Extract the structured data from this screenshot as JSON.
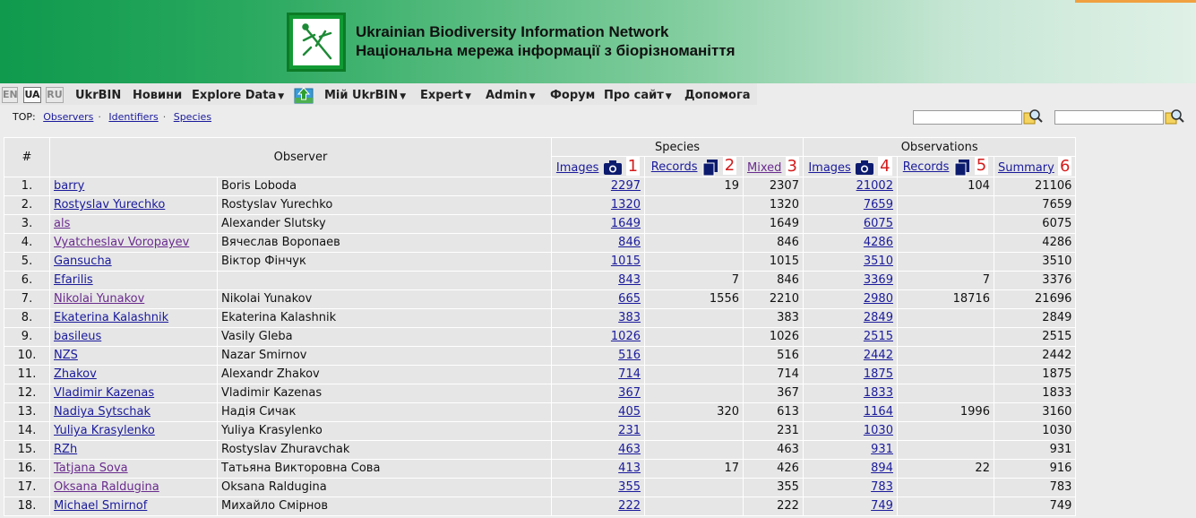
{
  "banner": {
    "title_en": "Ukrainian Biodiversity Information Network",
    "title_ua": "Національна мережа інформації з біорізноманіття"
  },
  "languages": [
    {
      "code": "EN",
      "active": false
    },
    {
      "code": "UA",
      "active": true
    },
    {
      "code": "RU",
      "active": false
    }
  ],
  "menu": {
    "ukrbin": "UkrBIN",
    "news": "Новини",
    "explore": "Explore Data",
    "my": "Мій UkrBIN",
    "expert": "Expert",
    "admin": "Admin",
    "forum": "Форум",
    "about": "Про сайт",
    "help": "Допомога"
  },
  "top": {
    "label": "TOP:",
    "observers": "Observers",
    "identifiers": "Identifiers",
    "species": "Species"
  },
  "table": {
    "h_num": "#",
    "h_observer": "Observer",
    "h_species": "Species",
    "h_observations": "Observations",
    "sp_images": "Images",
    "sp_records": "Records",
    "sp_mixed": "Mixed",
    "ob_images": "Images",
    "ob_records": "Records",
    "ob_summary": "Summary",
    "markers": [
      "1",
      "2",
      "3",
      "4",
      "5",
      "6"
    ],
    "rows": [
      {
        "n": "1.",
        "login": "barry",
        "name": "Boris Loboda",
        "si": "2297",
        "sr": "19",
        "sm": "2307",
        "oi": "21002",
        "or": "104",
        "os": "21106",
        "v": false
      },
      {
        "n": "2.",
        "login": "Rostyslav Yurechko",
        "name": "Rostyslav Yurechko",
        "si": "1320",
        "sr": "",
        "sm": "1320",
        "oi": "7659",
        "or": "",
        "os": "7659",
        "v": false
      },
      {
        "n": "3.",
        "login": "als",
        "name": "Alexander Slutsky",
        "si": "1649",
        "sr": "",
        "sm": "1649",
        "oi": "6075",
        "or": "",
        "os": "6075",
        "v": true
      },
      {
        "n": "4.",
        "login": "Vyatcheslav Voropayev",
        "name": "Вячеслав Воропаев",
        "si": "846",
        "sr": "",
        "sm": "846",
        "oi": "4286",
        "or": "",
        "os": "4286",
        "v": true
      },
      {
        "n": "5.",
        "login": "Gansucha",
        "name": "Віктор Фінчук",
        "si": "1015",
        "sr": "",
        "sm": "1015",
        "oi": "3510",
        "or": "",
        "os": "3510",
        "v": false
      },
      {
        "n": "6.",
        "login": "Efarilis",
        "name": "",
        "si": "843",
        "sr": "7",
        "sm": "846",
        "oi": "3369",
        "or": "7",
        "os": "3376",
        "v": false
      },
      {
        "n": "7.",
        "login": "Nikolai Yunakov",
        "name": "Nikolai Yunakov",
        "si": "665",
        "sr": "1556",
        "sm": "2210",
        "oi": "2980",
        "or": "18716",
        "os": "21696",
        "v": true
      },
      {
        "n": "8.",
        "login": "Ekaterina Kalashnik",
        "name": "Ekaterina Kalashnik",
        "si": "383",
        "sr": "",
        "sm": "383",
        "oi": "2849",
        "or": "",
        "os": "2849",
        "v": false
      },
      {
        "n": "9.",
        "login": "basileus",
        "name": "Vasily Gleba",
        "si": "1026",
        "sr": "",
        "sm": "1026",
        "oi": "2515",
        "or": "",
        "os": "2515",
        "v": false
      },
      {
        "n": "10.",
        "login": "NZS",
        "name": "Nazar Smirnov",
        "si": "516",
        "sr": "",
        "sm": "516",
        "oi": "2442",
        "or": "",
        "os": "2442",
        "v": false
      },
      {
        "n": "11.",
        "login": "Zhakov",
        "name": "Alexandr Zhakov",
        "si": "714",
        "sr": "",
        "sm": "714",
        "oi": "1875",
        "or": "",
        "os": "1875",
        "v": false
      },
      {
        "n": "12.",
        "login": "Vladimir Kazenas",
        "name": "Vladimir Kazenas",
        "si": "367",
        "sr": "",
        "sm": "367",
        "oi": "1833",
        "or": "",
        "os": "1833",
        "v": false
      },
      {
        "n": "13.",
        "login": "Nadiya Sytschak",
        "name": "Надія Сичак",
        "si": "405",
        "sr": "320",
        "sm": "613",
        "oi": "1164",
        "or": "1996",
        "os": "3160",
        "v": false
      },
      {
        "n": "14.",
        "login": "Yuliya Krasylenko",
        "name": "Yuliya Krasylenko",
        "si": "231",
        "sr": "",
        "sm": "231",
        "oi": "1030",
        "or": "",
        "os": "1030",
        "v": false
      },
      {
        "n": "15.",
        "login": "RZh",
        "name": "Rostyslav Zhuravchak",
        "si": "463",
        "sr": "",
        "sm": "463",
        "oi": "931",
        "or": "",
        "os": "931",
        "v": false
      },
      {
        "n": "16.",
        "login": "Tatjana Sova",
        "name": "Татьяна Викторовна Сова",
        "si": "413",
        "sr": "17",
        "sm": "426",
        "oi": "894",
        "or": "22",
        "os": "916",
        "v": true
      },
      {
        "n": "17.",
        "login": "Oksana Raldugina",
        "name": "Oksana Raldugina",
        "si": "355",
        "sr": "",
        "sm": "355",
        "oi": "783",
        "or": "",
        "os": "783",
        "v": true
      },
      {
        "n": "18.",
        "login": "Michael Smirnof",
        "name": "Михайло Смірнов",
        "si": "222",
        "sr": "",
        "sm": "222",
        "oi": "749",
        "or": "",
        "os": "749",
        "v": false
      }
    ]
  }
}
